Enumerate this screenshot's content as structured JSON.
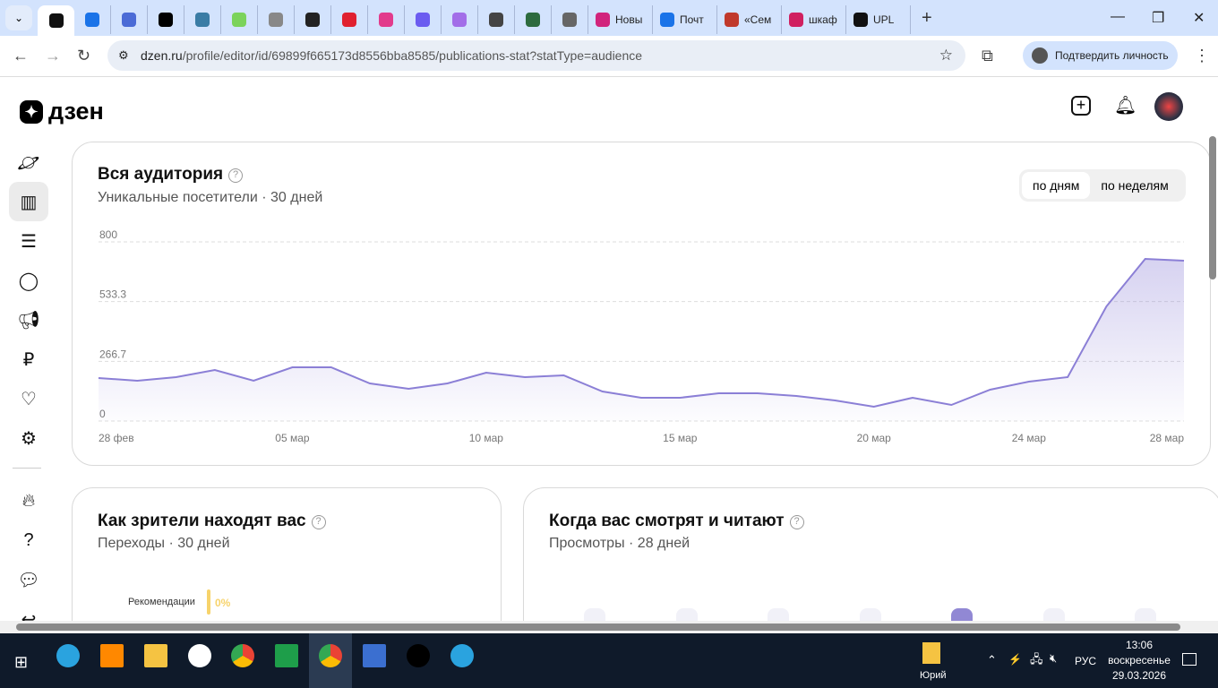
{
  "browser": {
    "tabs": [
      {
        "label": ""
      },
      {
        "label": ""
      },
      {
        "label": ""
      },
      {
        "label": ""
      },
      {
        "label": ""
      },
      {
        "label": ""
      },
      {
        "label": ""
      },
      {
        "label": ""
      },
      {
        "label": ""
      },
      {
        "label": ""
      },
      {
        "label": ""
      },
      {
        "label": ""
      },
      {
        "label": ""
      },
      {
        "label": ""
      },
      {
        "label": ""
      },
      {
        "label": "Новы"
      },
      {
        "label": "Почт"
      },
      {
        "label": "«Сем"
      },
      {
        "label": "шкаф"
      },
      {
        "label": "UPL"
      }
    ],
    "url_host": "dzen.ru",
    "url_path": "/profile/editor/id/69899f665173d8556bba8585/publications-stat?statType=audience",
    "verify_label": "Подтвердить личность"
  },
  "app": {
    "logo": "дзен"
  },
  "audience": {
    "title": "Вся аудитория",
    "subtitle": "Уникальные посетители · 30 дней",
    "toggle": [
      "по дням",
      "по неделям"
    ]
  },
  "chart_data": {
    "type": "area",
    "title": "Вся аудитория",
    "ylim": [
      0,
      800
    ],
    "yticks": [
      "0",
      "266.7",
      "533.3",
      "800"
    ],
    "xtick_labels": [
      {
        "i": 0,
        "label": "28 фев"
      },
      {
        "i": 5,
        "label": "05 мар"
      },
      {
        "i": 10,
        "label": "10 мар"
      },
      {
        "i": 15,
        "label": "15 мар"
      },
      {
        "i": 20,
        "label": "20 мар"
      },
      {
        "i": 24,
        "label": "24 мар"
      },
      {
        "i": 28,
        "label": "28 мар"
      }
    ],
    "values": [
      192,
      180,
      196,
      228,
      180,
      240,
      240,
      168,
      144,
      168,
      216,
      196,
      204,
      132,
      104,
      104,
      124,
      124,
      112,
      92,
      64,
      104,
      72,
      140,
      176,
      196,
      512,
      724,
      716
    ],
    "color": "#8b7fd6"
  },
  "sources": {
    "title": "Как зрители находят вас",
    "subtitle": "Переходы · 30 дней",
    "rows": [
      {
        "label": "Рекомендации",
        "value": "0%"
      }
    ]
  },
  "timing": {
    "title": "Когда вас смотрят и читают",
    "subtitle": "Просмотры · 28 дней"
  },
  "taskbar": {
    "user": "Юрий",
    "lang": "РУС",
    "time": "13:06",
    "weekday": "воскресенье",
    "date": "29.03.2026"
  }
}
